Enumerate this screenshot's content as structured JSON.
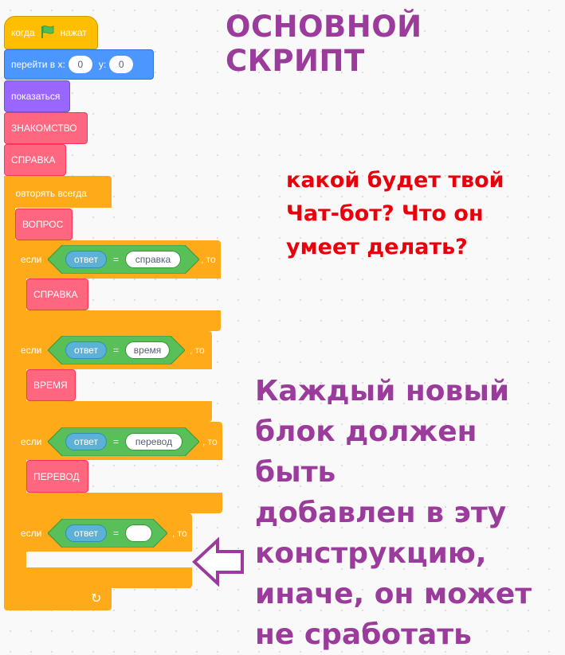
{
  "script": {
    "when_flag": {
      "label_start": "когда",
      "label_end": "нажат"
    },
    "go_to": {
      "label": "перейти в x:",
      "x": "0",
      "y_label": "y:",
      "y": "0"
    },
    "show": "показаться",
    "intro": "ЗНАКОМСТВО",
    "help": "СПРАВКА",
    "forever": "повторять всегда",
    "question": "ВОПРОС",
    "if_label": "если",
    "then_label": ", то",
    "answer": "ответ",
    "equals": "=",
    "conditions": [
      {
        "value": "справка",
        "action": "СПРАВКА"
      },
      {
        "value": "время",
        "action": "ВРЕМЯ"
      },
      {
        "value": "перевод",
        "action": "ПЕРЕВОД"
      },
      {
        "value": "",
        "action": ""
      }
    ],
    "loop_arrow": "↻"
  },
  "notes": {
    "title": "ОСНОВНОЙ СКРИПТ",
    "question_lines": [
      "какой будет твой",
      "Чат-бот? Что он",
      "умеет делать?"
    ],
    "instruction_lines": [
      "Каждый новый",
      "блок должен быть",
      "добавлен в эту",
      "конструкцию,",
      "иначе, он может",
      "не сработать"
    ]
  },
  "colors": {
    "events": "#ffbf00",
    "motion": "#4c97ff",
    "looks": "#9966ff",
    "custom": "#ff6680",
    "control": "#ffab19",
    "operators": "#59c059",
    "sensing": "#5cb1d6",
    "title_purple": "#9b3b9b",
    "question_red": "#e8000b"
  }
}
